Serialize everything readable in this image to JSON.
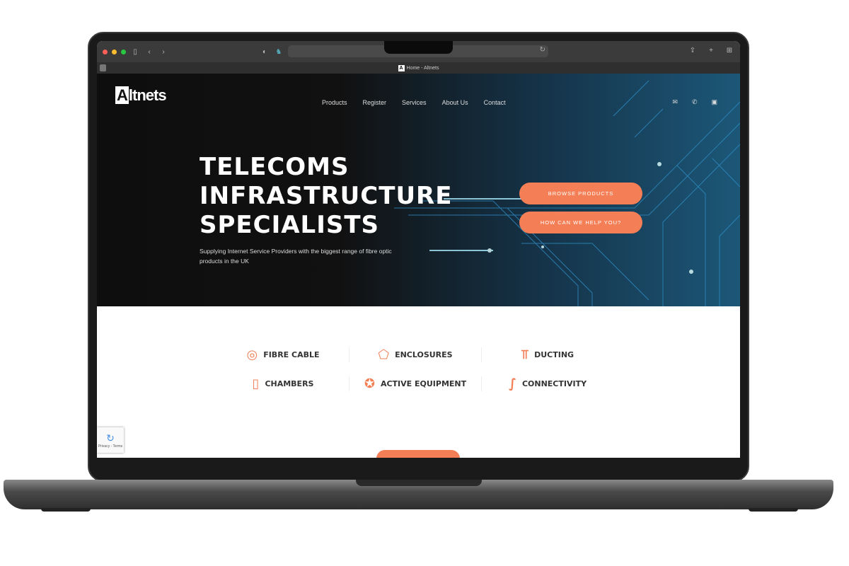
{
  "browser": {
    "tab_title": "Home - Altnets",
    "favicon": "A"
  },
  "site": {
    "logo": {
      "a": "A",
      "rest": "ltnets"
    },
    "nav": [
      "Products",
      "Register",
      "Services",
      "About Us",
      "Contact"
    ],
    "socials": [
      "email-icon",
      "phone-icon",
      "linkedin-icon"
    ],
    "hero": {
      "title_lines": [
        "TELECOMS",
        "INFRASTRUCTURE",
        "SPECIALISTS"
      ],
      "subtitle": "Supplying Internet Service Providers with the biggest range of fibre optic products in the UK",
      "buttons": [
        "BROWSE PRODUCTS",
        "HOW CAN WE HELP YOU?"
      ]
    },
    "categories": [
      [
        {
          "label": "FIBRE CABLE",
          "icon": "cable-reel-icon"
        },
        {
          "label": "ENCLOSURES",
          "icon": "enclosure-icon"
        },
        {
          "label": "DUCTING",
          "icon": "ducting-icon"
        }
      ],
      [
        {
          "label": "CHAMBERS",
          "icon": "chamber-icon"
        },
        {
          "label": "ACTIVE EQUIPMENT",
          "icon": "check-badge-icon"
        },
        {
          "label": "CONNECTIVITY",
          "icon": "connector-icon"
        }
      ]
    ],
    "recaptcha": "Privacy - Terms"
  },
  "colors": {
    "accent": "#f47f56",
    "hero_dark": "#0e0e0e",
    "hero_blue": "#1c5778"
  }
}
